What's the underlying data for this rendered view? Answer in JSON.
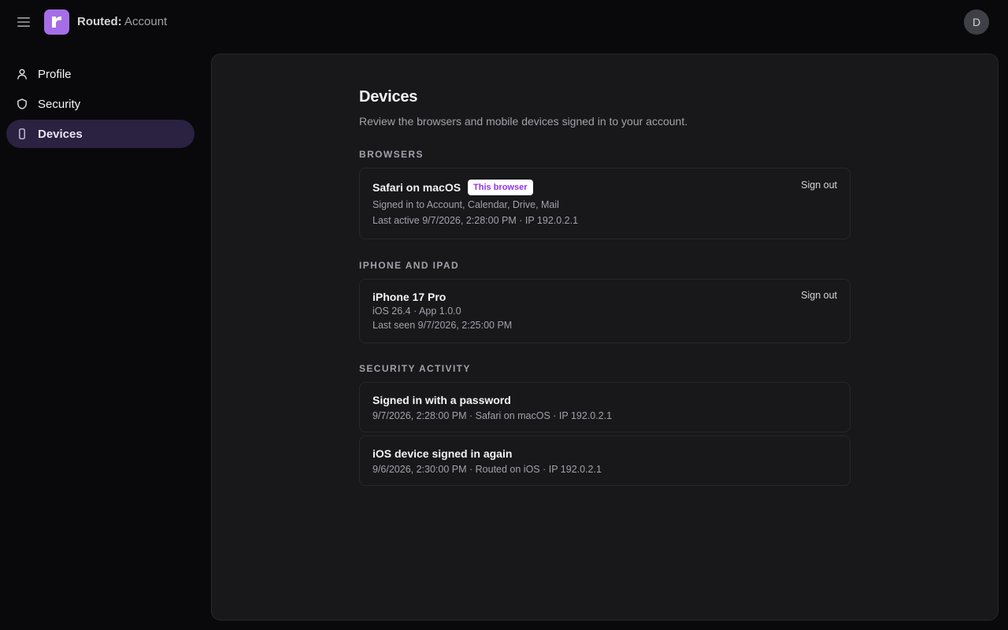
{
  "header": {
    "brand": "Routed:",
    "section": "Account",
    "logo_letter": "r",
    "avatar_initial": "D",
    "menu_icon": "hamburger-icon",
    "accent_color": "#a56ee8"
  },
  "sidebar": {
    "items": [
      {
        "label": "Profile",
        "icon": "person-icon",
        "active": false
      },
      {
        "label": "Security",
        "icon": "shield-icon",
        "active": false
      },
      {
        "label": "Devices",
        "icon": "phone-icon",
        "active": true
      }
    ]
  },
  "page": {
    "title": "Devices",
    "description": "Review the browsers and mobile devices signed in to your account."
  },
  "browsers": {
    "heading": "BROWSERS",
    "items": [
      {
        "name": "Safari on macOS",
        "badge": "This browser",
        "services": "Signed in to Account, Calendar, Drive, Mail",
        "last_active": "Last active 9/7/2026, 2:28:00 PM · IP 192.0.2.1",
        "action": "Sign out"
      }
    ]
  },
  "mobile": {
    "heading": "IPHONE AND IPAD",
    "items": [
      {
        "name": "iPhone 17 Pro",
        "version": "iOS 26.4 · App 1.0.0",
        "last_seen": "Last seen 9/7/2026, 2:25:00 PM",
        "action": "Sign out"
      }
    ]
  },
  "activity": {
    "heading": "SECURITY ACTIVITY",
    "items": [
      {
        "title": "Signed in with a password",
        "detail": "9/7/2026, 2:28:00 PM · Safari on macOS · IP 192.0.2.1"
      },
      {
        "title": "iOS device signed in again",
        "detail": "9/6/2026, 2:30:00 PM · Routed on iOS · IP 192.0.2.1"
      }
    ]
  }
}
